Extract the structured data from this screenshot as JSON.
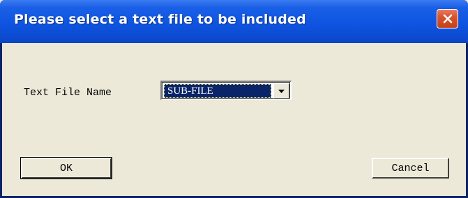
{
  "window": {
    "title": "Please select a text file to be included"
  },
  "titlebar": {
    "close_icon": "close-icon",
    "close_symbol": "✕"
  },
  "form": {
    "file_label": "Text File Name",
    "file_select": {
      "selected": "SUB-FILE",
      "dropdown_icon": "chevron-down-icon"
    }
  },
  "buttons": {
    "ok_label": "OK",
    "cancel_label": "Cancel"
  },
  "colors": {
    "title_bar": "#0E54E0",
    "close_button": "#D9532D",
    "dialog_face": "#ECE9D8",
    "selection": "#0A246A"
  }
}
